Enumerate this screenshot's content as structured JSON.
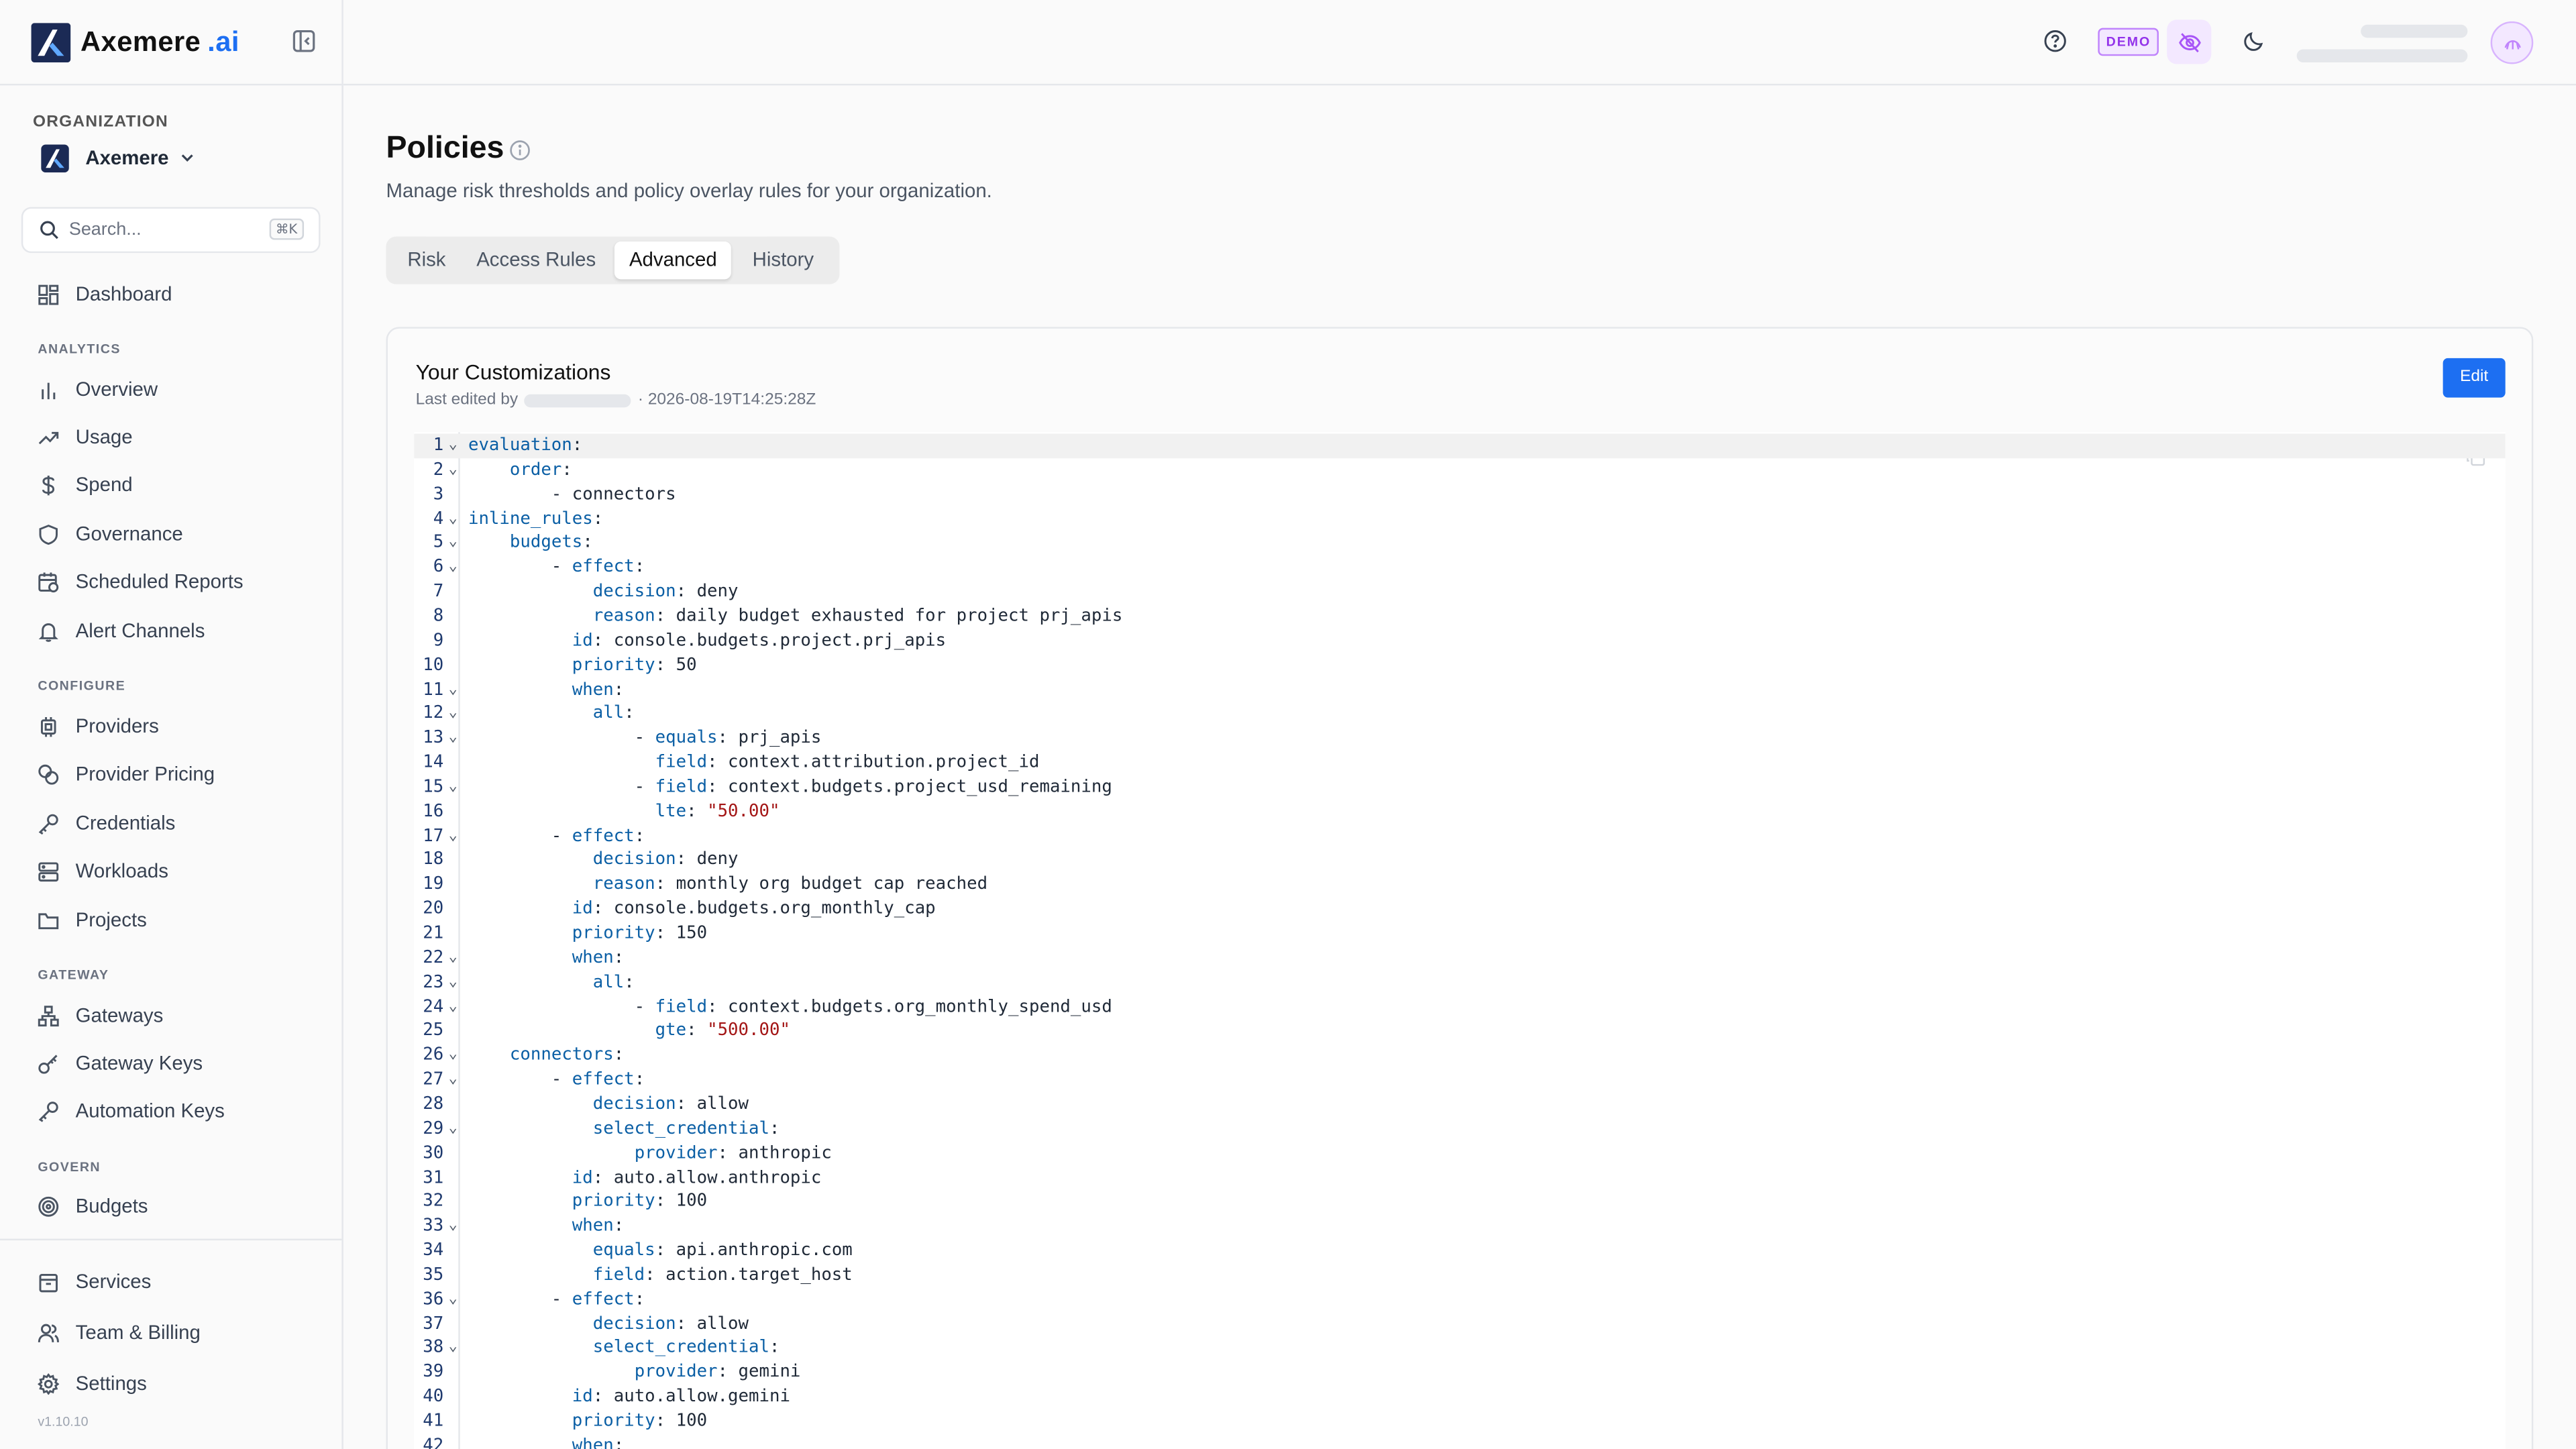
{
  "brand": {
    "name": "Axemere",
    "suffix": ".ai"
  },
  "sidebar": {
    "org_label": "ORGANIZATION",
    "org_name": "Axemere",
    "search_placeholder": "Search...",
    "search_shortcut": "⌘K",
    "dashboard": "Dashboard",
    "sections": {
      "analytics": "ANALYTICS",
      "configure": "CONFIGURE",
      "gateway": "GATEWAY",
      "govern": "GOVERN"
    },
    "analytics_items": [
      "Overview",
      "Usage",
      "Spend",
      "Governance",
      "Scheduled Reports",
      "Alert Channels"
    ],
    "configure_items": [
      "Providers",
      "Provider Pricing",
      "Credentials",
      "Workloads",
      "Projects"
    ],
    "gateway_items": [
      "Gateways",
      "Gateway Keys",
      "Automation Keys"
    ],
    "govern_items": [
      "Budgets"
    ],
    "footer_items": [
      "Services",
      "Team & Billing",
      "Settings"
    ],
    "version": "v1.10.10"
  },
  "header": {
    "demo_badge": "DEMO"
  },
  "page": {
    "title": "Policies",
    "subtitle": "Manage risk thresholds and policy overlay rules for your organization.",
    "tabs": [
      "Risk",
      "Access Rules",
      "Advanced",
      "History"
    ],
    "active_tab": "Advanced"
  },
  "card": {
    "title": "Your Customizations",
    "edited_prefix": "Last edited by",
    "edited_time": "· 2026-08-19T14:25:28Z",
    "edit_label": "Edit"
  },
  "colors": {
    "accent": "#1d6ff2",
    "demo": "#9333ea",
    "yaml_key": "#0b5fa5",
    "yaml_string": "#a31515"
  },
  "code_lines": [
    "evaluation:",
    "    order:",
    "        - connectors",
    "inline_rules:",
    "    budgets:",
    "        - effect:",
    "            decision: deny",
    "            reason: daily budget exhausted for project prj_apis",
    "          id: console.budgets.project.prj_apis",
    "          priority: 50",
    "          when:",
    "            all:",
    "                - equals: prj_apis",
    "                  field: context.attribution.project_id",
    "                - field: context.budgets.project_usd_remaining",
    "                  lte: \"50.00\"",
    "        - effect:",
    "            decision: deny",
    "            reason: monthly org budget cap reached",
    "          id: console.budgets.org_monthly_cap",
    "          priority: 150",
    "          when:",
    "            all:",
    "                - field: context.budgets.org_monthly_spend_usd",
    "                  gte: \"500.00\"",
    "    connectors:",
    "        - effect:",
    "            decision: allow",
    "            select_credential:",
    "                provider: anthropic",
    "          id: auto.allow.anthropic",
    "          priority: 100",
    "          when:",
    "            equals: api.anthropic.com",
    "            field: action.target_host",
    "        - effect:",
    "            decision: allow",
    "            select_credential:",
    "                provider: gemini",
    "          id: auto.allow.gemini",
    "          priority: 100",
    "          when:"
  ],
  "fold_lines": [
    1,
    2,
    4,
    5,
    6,
    11,
    12,
    13,
    15,
    17,
    22,
    23,
    24,
    26,
    27,
    29,
    33,
    36,
    38
  ]
}
